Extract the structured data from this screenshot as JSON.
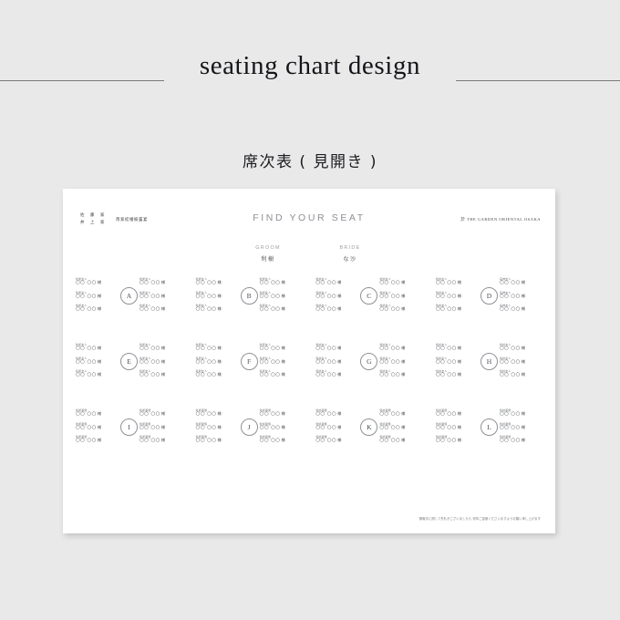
{
  "header": {
    "title": "seating chart design"
  },
  "subtitle": "席次表 ( 見開き )",
  "card": {
    "families": [
      "佐 藤 家",
      "井 上 家"
    ],
    "occasion": "両家結婚披露宴",
    "heading": "FIND YOUR SEAT",
    "venue": "於 THE GARDEN ORIENTAL OSAKA",
    "couple": {
      "groom": {
        "role": "GROOM",
        "name": "利樹"
      },
      "bride": {
        "role": "BRIDE",
        "name": "な沙"
      }
    },
    "note": "御席次に関して失礼がございましたら 何卒ご容赦くださいますようお願い申し上げます",
    "guest_name": "○○ ○○",
    "honorific": "様",
    "tables": [
      {
        "label": "A",
        "left": [
          {
            "relation": "新郎友人"
          },
          {
            "relation": "新郎友人"
          },
          {
            "relation": "新郎友人"
          }
        ],
        "right": [
          {
            "relation": "新郎友人"
          },
          {
            "relation": "新郎友人"
          },
          {
            "relation": "新郎友人"
          }
        ]
      },
      {
        "label": "B",
        "left": [
          {
            "relation": "新郎友人"
          },
          {
            "relation": "新郎友人"
          },
          {
            "relation": "新郎友人"
          }
        ],
        "right": [
          {
            "relation": "新郎友人"
          },
          {
            "relation": "新郎友人"
          },
          {
            "relation": "新郎友人"
          }
        ]
      },
      {
        "label": "C",
        "left": [
          {
            "relation": "新婦友人"
          },
          {
            "relation": "新婦友人"
          },
          {
            "relation": "新婦友人"
          }
        ],
        "right": [
          {
            "relation": "新婦友人"
          },
          {
            "relation": "新婦友人"
          },
          {
            "relation": "新婦友人"
          }
        ]
      },
      {
        "label": "D",
        "left": [
          {
            "relation": "新婦友人"
          },
          {
            "relation": "新婦友人"
          },
          {
            "relation": "新婦友人"
          }
        ],
        "right": [
          {
            "relation": "長姉友人"
          },
          {
            "relation": "長姉友人"
          },
          {
            "relation": "長姉友人"
          }
        ]
      },
      {
        "label": "E",
        "left": [
          {
            "relation": "新郎友人"
          },
          {
            "relation": "新郎友人"
          },
          {
            "relation": "新郎友人"
          }
        ],
        "right": [
          {
            "relation": "新郎友人"
          },
          {
            "relation": "新郎友人"
          },
          {
            "relation": "新郎友人"
          }
        ]
      },
      {
        "label": "F",
        "left": [
          {
            "relation": "新郎友人"
          },
          {
            "relation": "新郎友人"
          },
          {
            "relation": "新郎友人"
          }
        ],
        "right": [
          {
            "relation": "新郎友人"
          },
          {
            "relation": "新郎友人"
          },
          {
            "relation": "新郎友人"
          }
        ]
      },
      {
        "label": "G",
        "left": [
          {
            "relation": "新婦友人"
          },
          {
            "relation": "新婦友人"
          },
          {
            "relation": "新婦友人"
          }
        ],
        "right": [
          {
            "relation": "新婦友人"
          },
          {
            "relation": "新婦友人"
          },
          {
            "relation": "新婦友人"
          }
        ]
      },
      {
        "label": "H",
        "left": [
          {
            "relation": "新婦友人"
          },
          {
            "relation": "新婦友人"
          },
          {
            "relation": "新婦友人"
          }
        ],
        "right": [
          {
            "relation": "新婦友人"
          },
          {
            "relation": "新婦友人"
          },
          {
            "relation": "新婦友人"
          }
        ]
      },
      {
        "label": "I",
        "left": [
          {
            "relation": "新郎親族"
          },
          {
            "relation": "新郎親族"
          },
          {
            "relation": "新郎親族"
          }
        ],
        "right": [
          {
            "relation": "新郎親族"
          },
          {
            "relation": "新郎親族"
          },
          {
            "relation": "新郎親族"
          }
        ]
      },
      {
        "label": "J",
        "left": [
          {
            "relation": "新郎親族"
          },
          {
            "relation": "新郎親族"
          },
          {
            "relation": "新郎親族"
          }
        ],
        "right": [
          {
            "relation": "新婦親族"
          },
          {
            "relation": "新婦親族"
          },
          {
            "relation": "新婦親族"
          }
        ]
      },
      {
        "label": "K",
        "left": [
          {
            "relation": "新婦親族"
          },
          {
            "relation": "新婦親族"
          },
          {
            "relation": "新婦親族"
          }
        ],
        "right": [
          {
            "relation": "新婦親族"
          },
          {
            "relation": "新婦親族"
          },
          {
            "relation": "新婦親族"
          }
        ]
      },
      {
        "label": "L",
        "left": [
          {
            "relation": "新婦親族"
          },
          {
            "relation": "新婦親族"
          },
          {
            "relation": "新婦親族"
          }
        ],
        "right": [
          {
            "relation": "新婦親族"
          },
          {
            "relation": "新婦親族"
          },
          {
            "relation": "新婦親族"
          }
        ]
      }
    ]
  }
}
